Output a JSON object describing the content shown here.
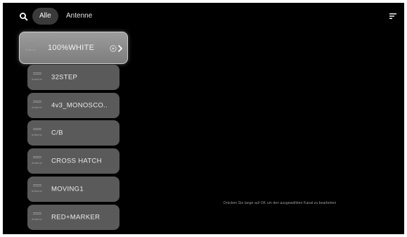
{
  "tabs": {
    "all": "Alle",
    "antenne": "Antenne"
  },
  "icons": {
    "search": "search-icon",
    "sort": "sort-icon",
    "info": "info-icon",
    "chevron": "chevron-right-icon"
  },
  "channel_source_label": "Antenne",
  "channels": [
    {
      "name": "100%WHITE",
      "focused": true
    },
    {
      "name": "32STEP"
    },
    {
      "name": "4v3_MONOSCO.."
    },
    {
      "name": "C/B"
    },
    {
      "name": "CROSS HATCH"
    },
    {
      "name": "MOVING1"
    },
    {
      "name": "RED+MARKER"
    }
  ],
  "hint": "Drücken Sie lange auf OK um den ausgewählten Kanal zu bearbeiten",
  "colors": {
    "background": "#000000",
    "tile": "#5a5a5a",
    "focused_tile": "#8c8c8c",
    "text": "#eaeaea"
  }
}
